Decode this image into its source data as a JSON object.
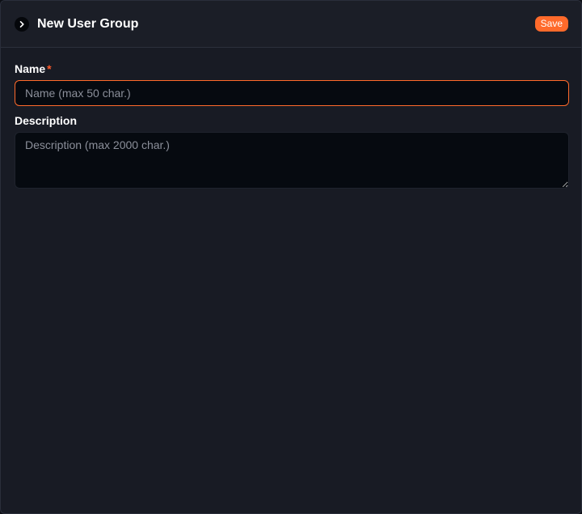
{
  "header": {
    "title": "New User Group",
    "save_label": "Save",
    "collapse_icon": "chevron-right-icon"
  },
  "form": {
    "name": {
      "label": "Name",
      "required_marker": "*",
      "value": "",
      "placeholder": "Name (max 50 char.)"
    },
    "description": {
      "label": "Description",
      "value": "",
      "placeholder": "Description (max 2000 char.)"
    }
  },
  "colors": {
    "accent": "#ff6a2b",
    "required": "#ff5a2a",
    "panel_bg": "#181b24",
    "input_bg": "#060a10",
    "text": "#ffffff",
    "placeholder": "#8b8f9a"
  }
}
